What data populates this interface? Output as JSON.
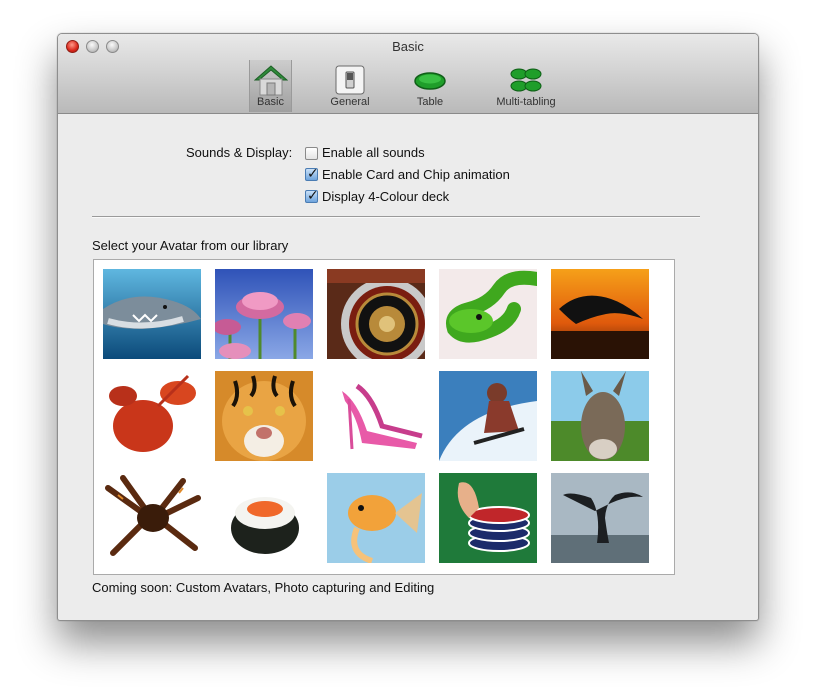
{
  "window": {
    "title": "Basic"
  },
  "toolbar": {
    "tabs": [
      {
        "label": "Basic",
        "icon": "house-icon",
        "selected": true
      },
      {
        "label": "General",
        "icon": "switch-icon",
        "selected": false
      },
      {
        "label": "Table",
        "icon": "poker-table-icon",
        "selected": false
      },
      {
        "label": "Multi-tabling",
        "icon": "multi-table-icon",
        "selected": false
      }
    ]
  },
  "sounds_display": {
    "label": "Sounds & Display:",
    "options": [
      {
        "label": "Enable all sounds",
        "checked": false
      },
      {
        "label": "Enable Card and Chip animation",
        "checked": true
      },
      {
        "label": "Display 4-Colour deck",
        "checked": true
      }
    ]
  },
  "avatars": {
    "heading": "Select your Avatar from our library",
    "items": [
      {
        "name": "shark"
      },
      {
        "name": "flowers"
      },
      {
        "name": "roulette"
      },
      {
        "name": "green-snake"
      },
      {
        "name": "dolphin-sunset"
      },
      {
        "name": "lobster"
      },
      {
        "name": "tiger"
      },
      {
        "name": "pink-heels"
      },
      {
        "name": "snowboarder"
      },
      {
        "name": "donkey"
      },
      {
        "name": "tarantula"
      },
      {
        "name": "sushi"
      },
      {
        "name": "goldfish"
      },
      {
        "name": "poker-chips"
      },
      {
        "name": "whale-tail"
      }
    ]
  },
  "footer": {
    "note": "Coming soon: Custom Avatars, Photo capturing and Editing"
  },
  "colors": {
    "checkbox_checked": "#6fa4dc",
    "table_green": "#1f9e2a"
  }
}
